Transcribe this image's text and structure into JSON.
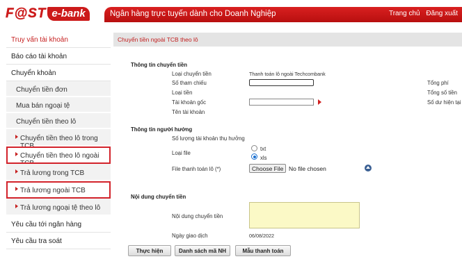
{
  "header": {
    "logo_fast": "F@ST",
    "logo_ebank": "e-bank",
    "title": "Ngân hàng trực tuyến dành cho Doanh Nghiệp",
    "nav_home": "Trang chủ",
    "nav_logout": "Đăng xuất"
  },
  "sidebar": {
    "items": [
      {
        "label": "Truy vấn tài khoản"
      },
      {
        "label": "Báo cáo tài khoản"
      },
      {
        "label": "Chuyển khoản"
      },
      {
        "label": "Chuyển tiền đơn"
      },
      {
        "label": "Mua bán ngoại tệ"
      },
      {
        "label": "Chuyển tiền theo lô"
      },
      {
        "label": "Chuyển tiền theo lô trong TCB"
      },
      {
        "label": "Chuyển tiền theo lô ngoài TCB"
      },
      {
        "label": "Trả lương trong TCB"
      },
      {
        "label": "Trả lương ngoài TCB"
      },
      {
        "label": "Trả lương ngoại tệ theo lô"
      },
      {
        "label": "Yêu cầu tới ngân hàng"
      },
      {
        "label": "Yêu cầu tra soát"
      }
    ]
  },
  "page": {
    "title": "Chuyển tiền ngoài TCB theo lô",
    "section_transfer": "Thông tin chuyển tiền",
    "transfer_type_label": "Loại chuyển tiền",
    "transfer_type_value": "Thanh toán lô ngoài Techcombank",
    "reference_label": "Số tham chiếu",
    "currency_label": "Loại tiền",
    "source_account_label": "Tài khoản gốc",
    "account_name_label": "Tên tài khoản",
    "total_fee_label": "Tổng phí",
    "total_amount_label": "Tổng số tiền",
    "balance_label": "Số dư hiện tại",
    "section_beneficiary": "Thông tin người hưởng",
    "beneficiary_count_label": "Số lượng tài khoản thụ hưởng",
    "file_type_label": "Loại file",
    "file_type_options": [
      "txt",
      "xls"
    ],
    "file_type_selected": "xls",
    "payment_file_label": "File thanh toán lô (*)",
    "choose_file_label": "Choose File",
    "no_file_label": "No file chosen",
    "section_content": "Nội dung chuyển tiền",
    "content_label": "Nội dung chuyển tiền",
    "date_label": "Ngày giao dịch",
    "date_value": "06/08/2022"
  },
  "buttons": {
    "execute": "Thực hiện",
    "bank_codes": "Danh sách mã NH",
    "payment_template": "Mẫu thanh toán"
  },
  "colors": {
    "brand_red": "#cc1a1a",
    "highlight_outline": "#d2222a"
  }
}
